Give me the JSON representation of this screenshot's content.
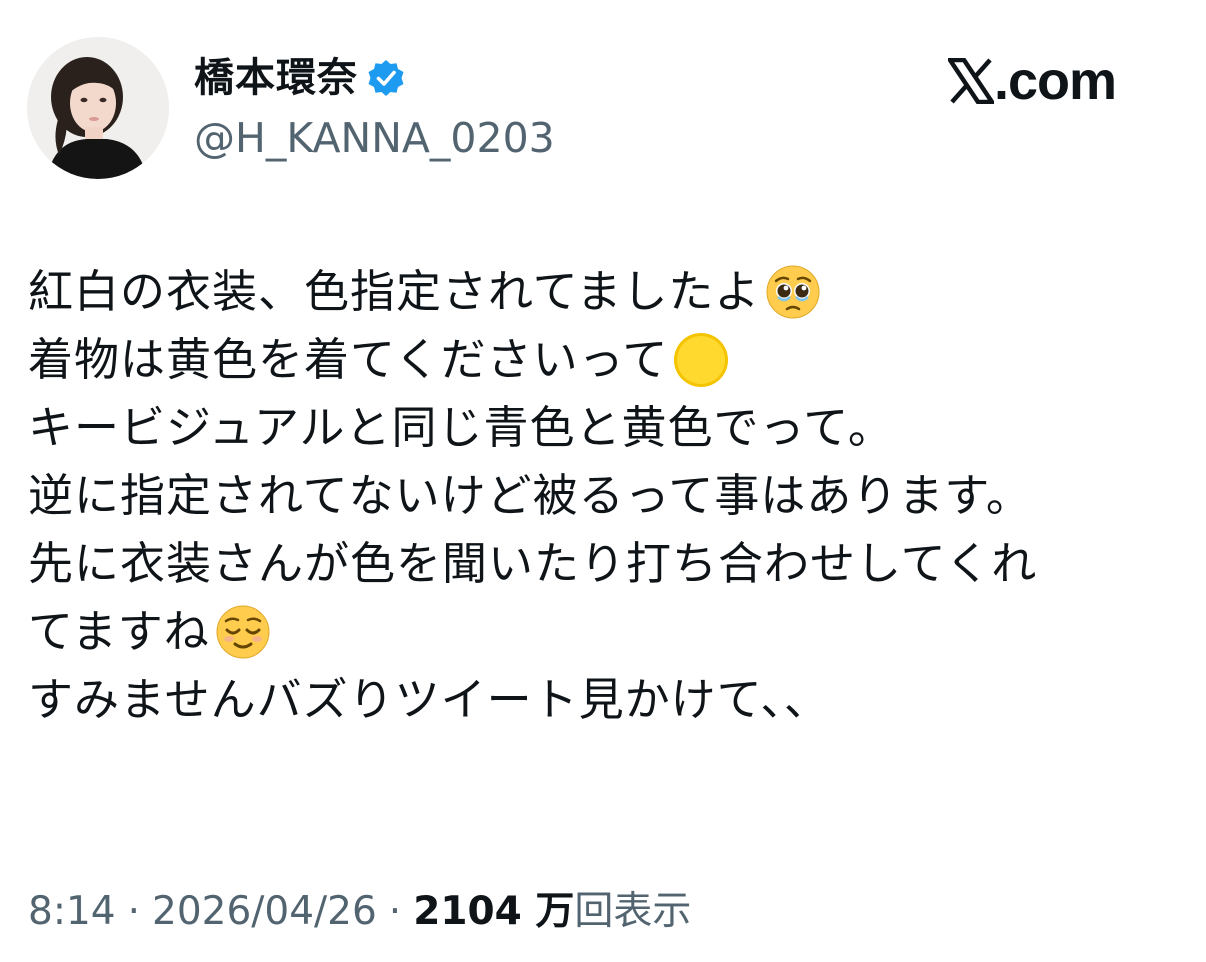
{
  "author": {
    "display_name": "橋本環奈",
    "handle": "@H_KANNA_0203",
    "verified": true,
    "avatar_icon": "profile-photo"
  },
  "brand": {
    "icon": "x-logo-icon",
    "text": ".com"
  },
  "tweet": {
    "lines": [
      {
        "text": "紅白の衣装、色指定されてましたよ",
        "emoji": "pleading-face-emoji"
      },
      {
        "text": "着物は黄色を着てくださいって",
        "emoji": "yellow-circle-emoji"
      },
      {
        "text": "キービジュアルと同じ青色と黄色でって。",
        "emoji": ""
      },
      {
        "text": "逆に指定されてないけど被るって事はあります。",
        "emoji": ""
      },
      {
        "text": "先に衣装さんが色を聞いたり打ち合わせしてくれ",
        "emoji": ""
      },
      {
        "text": "てますね",
        "emoji": "relieved-face-emoji"
      },
      {
        "text": "すみませんバズりツイート見かけて、、",
        "emoji": ""
      }
    ]
  },
  "meta": {
    "time": "8:14",
    "separator": "·",
    "date": "2026/04/26",
    "views_count": "2104 万",
    "views_label": "回表示"
  },
  "colors": {
    "text": "#0f1419",
    "secondary": "#536471",
    "verified_blue": "#1d9bf0",
    "background": "#ffffff"
  }
}
